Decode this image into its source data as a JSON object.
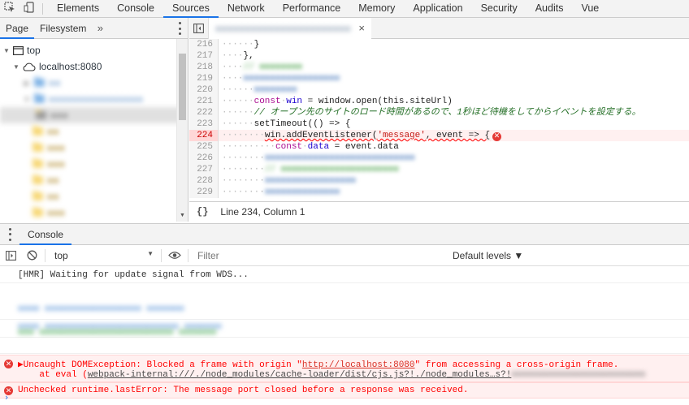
{
  "main_tabs": [
    "Elements",
    "Console",
    "Sources",
    "Network",
    "Performance",
    "Memory",
    "Application",
    "Security",
    "Audits",
    "Vue"
  ],
  "active_main_tab": "Sources",
  "navigator": {
    "tabs": [
      "Page",
      "Filesystem"
    ],
    "more": "»",
    "top_label": "top",
    "host_label": "localhost:8080"
  },
  "editor": {
    "file_close": "×",
    "lines": {
      "n216": "216",
      "n217": "217",
      "n218": "218",
      "n219": "219",
      "n220": "220",
      "n221": "221",
      "n222": "222",
      "n223": "223",
      "n224": "224",
      "n225": "225",
      "n226": "226",
      "n227": "227",
      "n228": "228",
      "n229": "229"
    },
    "code": {
      "l216": "}",
      "l217": "},",
      "l221_kw": "const",
      "l221_var": "win",
      "l221_rest": " = window.open(this.siteUrl)",
      "l222_comment": "// オープン先のサイトのロード時間があるので、1秒ほど待機をしてからイベントを設定する。",
      "l223": "setTimeout(() => {",
      "l224_pre": "win.addEventListener(",
      "l224_str": "'message'",
      "l224_post": ", event => {",
      "l225_kw": "const",
      "l225_var": "data",
      "l225_rest": " = event.data"
    },
    "status": {
      "braces": "{}",
      "position": "Line 234, Column 1"
    }
  },
  "drawer": {
    "tab": "Console"
  },
  "console_toolbar": {
    "context": "top",
    "filter_placeholder": "Filter",
    "levels": "Default levels ▼"
  },
  "messages": {
    "hmr": "[HMR] Waiting for update signal from WDS...",
    "error1_prefix": "▶Uncaught DOMException: Blocked a frame with origin \"",
    "error1_link": "http://localhost:8080",
    "error1_suffix": "\" from accessing a cross-origin frame.",
    "error1_line2_prefix": "    at eval (",
    "error1_line2_url": "webpack-internal:///./node_modules/cache-loader/dist/cjs.js?!./node_modules…s?!",
    "error2": "Unchecked runtime.lastError: The message port closed before a response was received."
  },
  "prompt": "›",
  "colors": {
    "accent": "#1a73e8",
    "error": "#ff0000",
    "error_bg": "#fff0f0",
    "toolbar_bg": "#f3f3f3"
  }
}
